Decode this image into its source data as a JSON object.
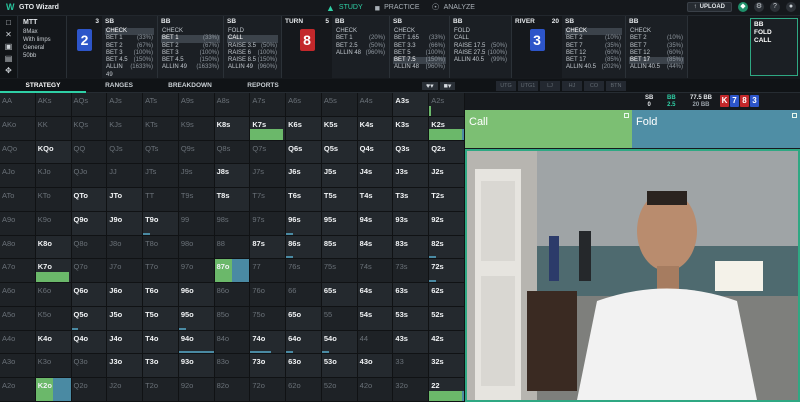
{
  "app": {
    "title": "GTO Wizard",
    "nav": [
      {
        "label": "STUDY",
        "icon": "graduation-cap-icon",
        "active": true
      },
      {
        "label": "PRACTICE",
        "icon": "cards-icon",
        "active": false
      },
      {
        "label": "ANALYZE",
        "icon": "bulb-icon",
        "active": false
      }
    ],
    "upload": "UPLOAD"
  },
  "mtt": {
    "title": "MTT",
    "lines": [
      "8Max",
      "With limps",
      "General",
      "50bb"
    ]
  },
  "streets": [
    {
      "pos": "SB",
      "num": "",
      "lines": [
        {
          "a": "CHECK",
          "p": "",
          "sel": true
        },
        {
          "a": "BET 1",
          "p": "(33%)"
        },
        {
          "a": "BET 2",
          "p": "(67%)"
        },
        {
          "a": "BET 3",
          "p": "(100%)"
        },
        {
          "a": "BET 4.5",
          "p": "(150%)"
        },
        {
          "a": "ALLIN 49",
          "p": "(1633%)"
        }
      ]
    },
    {
      "pos": "BB",
      "num": "",
      "lines": [
        {
          "a": "CHECK",
          "p": ""
        },
        {
          "a": "BET 1",
          "p": "(33%)",
          "sel": true
        },
        {
          "a": "BET 2",
          "p": "(67%)"
        },
        {
          "a": "BET 3",
          "p": "(100%)"
        },
        {
          "a": "BET 4.5",
          "p": "(150%)"
        },
        {
          "a": "ALLIN 49",
          "p": "(1633%)"
        }
      ]
    },
    {
      "pos": "SB",
      "num": "",
      "lines": [
        {
          "a": "FOLD",
          "p": ""
        },
        {
          "a": "CALL",
          "p": "",
          "sel": true
        },
        {
          "a": "RAISE 3.5",
          "p": "(50%)"
        },
        {
          "a": "RAISE 6",
          "p": "(100%)"
        },
        {
          "a": "RAISE 8.5",
          "p": "(150%)"
        },
        {
          "a": "ALLIN 49",
          "p": "(960%)"
        }
      ]
    },
    {
      "pos": "BB",
      "num": "",
      "lines": [
        {
          "a": "CHECK",
          "p": ""
        },
        {
          "a": "BET 1",
          "p": "(20%)"
        },
        {
          "a": "BET 2.5",
          "p": "(50%)"
        },
        {
          "a": "ALLIN 48",
          "p": "(960%)"
        }
      ]
    },
    {
      "pos": "SB",
      "num": "",
      "lines": [
        {
          "a": "CHECK",
          "p": ""
        },
        {
          "a": "BET 1.65",
          "p": "(33%)"
        },
        {
          "a": "BET 3.3",
          "p": "(66%)"
        },
        {
          "a": "BET 5",
          "p": "(100%)"
        },
        {
          "a": "BET 7.5",
          "p": "(150%)",
          "sel": true
        },
        {
          "a": "ALLIN 48",
          "p": "(960%)"
        }
      ]
    },
    {
      "pos": "BB",
      "num": "",
      "lines": [
        {
          "a": "FOLD",
          "p": ""
        },
        {
          "a": "CALL",
          "p": ""
        },
        {
          "a": "RAISE 17.5",
          "p": "(50%)"
        },
        {
          "a": "RAISE 27.5",
          "p": "(100%)"
        },
        {
          "a": "ALLIN 40.5",
          "p": "(99%)"
        }
      ]
    },
    {
      "pos": "SB",
      "num": "",
      "lines": [
        {
          "a": "CHECK",
          "p": "",
          "sel": true
        },
        {
          "a": "BET 2",
          "p": "(10%)"
        },
        {
          "a": "BET 7",
          "p": "(35%)"
        },
        {
          "a": "BET 12",
          "p": "(60%)"
        },
        {
          "a": "BET 17",
          "p": "(85%)"
        },
        {
          "a": "ALLIN 40.5",
          "p": "(202%)"
        }
      ]
    },
    {
      "pos": "BB",
      "num": "",
      "lines": [
        {
          "a": "CHECK",
          "p": ""
        },
        {
          "a": "BET 2",
          "p": "(10%)"
        },
        {
          "a": "BET 7",
          "p": "(35%)"
        },
        {
          "a": "BET 12",
          "p": "(60%)"
        },
        {
          "a": "BET 17",
          "p": "(85%)",
          "sel": true
        },
        {
          "a": "ALLIN 40.5",
          "p": "(44%)"
        }
      ]
    }
  ],
  "boards": [
    {
      "label": "",
      "num": "3",
      "card": "2",
      "color": "#2d55c9"
    },
    {
      "label": "TURN",
      "num": "5",
      "card": "8",
      "color": "#c3282b"
    },
    {
      "label": "RIVER",
      "num": "20",
      "card": "3",
      "color": "#2d55c9"
    }
  ],
  "final": {
    "pos": "BB",
    "lines": [
      "FOLD",
      "CALL"
    ]
  },
  "tabs": [
    "STRATEGY",
    "RANGES",
    "BREAKDOWN",
    "REPORTS"
  ],
  "positions": [
    "UTG",
    "UTG1",
    "LJ",
    "HJ",
    "CO",
    "BTN"
  ],
  "sb_stat": {
    "label": "SB",
    "value": "0"
  },
  "bb_stat": {
    "label": "BB",
    "value": "2.5"
  },
  "pot": {
    "value": "77.5 BB",
    "sub": "20 BB"
  },
  "board_cards": [
    {
      "c": "K",
      "color": "#c3282b"
    },
    {
      "c": "7",
      "color": "#2d55c9"
    },
    {
      "c": "8",
      "color": "#c3282b"
    },
    {
      "c": "3",
      "color": "#2d55c9"
    }
  ],
  "actions": [
    {
      "label": "Call",
      "color": "#7cbf73",
      "pct": 0.5
    },
    {
      "label": "Fold",
      "color": "#4f8ea5",
      "pct": 0.5
    }
  ],
  "colors": {
    "call": "#6bb86a",
    "fold": "#4a8aa3",
    "accent": "#2fd0a6"
  },
  "grid": [
    [
      "AA",
      "AKs",
      "AQs",
      "AJs",
      "ATs",
      "A9s",
      "A8s",
      "A7s",
      "A6s",
      "A5s",
      "A4s",
      "A3s",
      "A2s"
    ],
    [
      "AKo",
      "KK",
      "KQs",
      "KJs",
      "KTs",
      "K9s",
      "K8s",
      "K7s",
      "K6s",
      "K5s",
      "K4s",
      "K3s",
      "K2s"
    ],
    [
      "AQo",
      "KQo",
      "QQ",
      "QJs",
      "QTs",
      "Q9s",
      "Q8s",
      "Q7s",
      "Q6s",
      "Q5s",
      "Q4s",
      "Q3s",
      "Q2s"
    ],
    [
      "AJo",
      "KJo",
      "QJo",
      "JJ",
      "JTs",
      "J9s",
      "J8s",
      "J7s",
      "J6s",
      "J5s",
      "J4s",
      "J3s",
      "J2s"
    ],
    [
      "ATo",
      "KTo",
      "QTo",
      "JTo",
      "TT",
      "T9s",
      "T8s",
      "T7s",
      "T6s",
      "T5s",
      "T4s",
      "T3s",
      "T2s"
    ],
    [
      "A9o",
      "K9o",
      "Q9o",
      "J9o",
      "T9o",
      "99",
      "98s",
      "97s",
      "96s",
      "95s",
      "94s",
      "93s",
      "92s"
    ],
    [
      "A8o",
      "K8o",
      "Q8o",
      "J8o",
      "T8o",
      "98o",
      "88",
      "87s",
      "86s",
      "85s",
      "84s",
      "83s",
      "82s"
    ],
    [
      "A7o",
      "K7o",
      "Q7o",
      "J7o",
      "T7o",
      "97o",
      "87o",
      "77",
      "76s",
      "75s",
      "74s",
      "73s",
      "72s"
    ],
    [
      "A6o",
      "K6o",
      "Q6o",
      "J6o",
      "T6o",
      "96o",
      "86o",
      "76o",
      "66",
      "65s",
      "64s",
      "63s",
      "62s"
    ],
    [
      "A5o",
      "K5o",
      "Q5o",
      "J5o",
      "T5o",
      "95o",
      "85o",
      "75o",
      "65o",
      "55",
      "54s",
      "53s",
      "52s"
    ],
    [
      "A4o",
      "K4o",
      "Q4o",
      "J4o",
      "T4o",
      "94o",
      "84o",
      "74o",
      "64o",
      "54o",
      "44",
      "43s",
      "42s"
    ],
    [
      "A3o",
      "K3o",
      "Q3o",
      "J3o",
      "T3o",
      "93o",
      "83o",
      "73o",
      "63o",
      "53o",
      "43o",
      "33",
      "32s"
    ],
    [
      "A2o",
      "K2o",
      "Q2o",
      "J2o",
      "T2o",
      "92o",
      "82o",
      "72o",
      "62o",
      "52o",
      "42o",
      "32o",
      "22"
    ]
  ],
  "hot_hands": [
    "A3s",
    "K8s",
    "K7s",
    "K6s",
    "K5s",
    "K4s",
    "K3s",
    "K2s",
    "KQo",
    "Q6s",
    "Q5s",
    "Q4s",
    "Q3s",
    "Q2s",
    "J8s",
    "J6s",
    "J5s",
    "J4s",
    "J3s",
    "J2s",
    "QTo",
    "JTo",
    "T8s",
    "T6s",
    "T5s",
    "T4s",
    "T3s",
    "T2s",
    "Q9o",
    "J9o",
    "T9o",
    "96s",
    "95s",
    "94s",
    "93s",
    "92s",
    "K8o",
    "87s",
    "86s",
    "85s",
    "84s",
    "83s",
    "82s",
    "K7o",
    "87o",
    "72s",
    "Q6o",
    "J6o",
    "T6o",
    "96o",
    "65s",
    "64s",
    "63s",
    "62s",
    "Q5o",
    "J5o",
    "T5o",
    "95o",
    "65o",
    "54s",
    "53s",
    "52s",
    "K4o",
    "Q4o",
    "J4o",
    "T4o",
    "94o",
    "74o",
    "64o",
    "54o",
    "43s",
    "42s",
    "J3o",
    "T3o",
    "93o",
    "73o",
    "63o",
    "53o",
    "43o",
    "32s",
    "K2o",
    "22"
  ],
  "mix": {
    "K7s": {
      "call": 0.95,
      "fold": 0
    },
    "A2s": {
      "call": 0.05,
      "fold": 0
    },
    "K2s": {
      "call": 0.95,
      "fold": 0.05
    },
    "K7o": {
      "call": 0.95,
      "fold": 0
    },
    "87o": {
      "call": 0.5,
      "fold": 0.5
    },
    "K2o": {
      "call": 0.5,
      "fold": 0.5
    },
    "22": {
      "call": 0.95,
      "fold": 0.05
    },
    "96s": {
      "call": 0,
      "fold": 0.05,
      "bar": "fold"
    },
    "86s": {
      "call": 0,
      "fold": 0.05,
      "bar": "fold"
    },
    "72s": {
      "call": 0,
      "fold": 0.05,
      "bar": "fold"
    },
    "82s": {
      "call": 0,
      "fold": 0.05,
      "bar": "fold"
    },
    "95o": {
      "call": 0,
      "fold": 0.05,
      "bar": "fold"
    },
    "64o": {
      "call": 0,
      "fold": 0.05,
      "bar": "fold"
    },
    "94o": {
      "call": 0,
      "fold": 0.4,
      "bar": "fold"
    },
    "Q5o": {
      "call": 0,
      "fold": 0.05,
      "bar": "fold"
    },
    "54o": {
      "call": 0,
      "fold": 0.05,
      "bar": "fold"
    },
    "74o": {
      "call": 0,
      "fold": 0.15,
      "bar": "fold"
    },
    "T9o": {
      "call": 0,
      "fold": 0.05,
      "bar": "fold"
    }
  }
}
